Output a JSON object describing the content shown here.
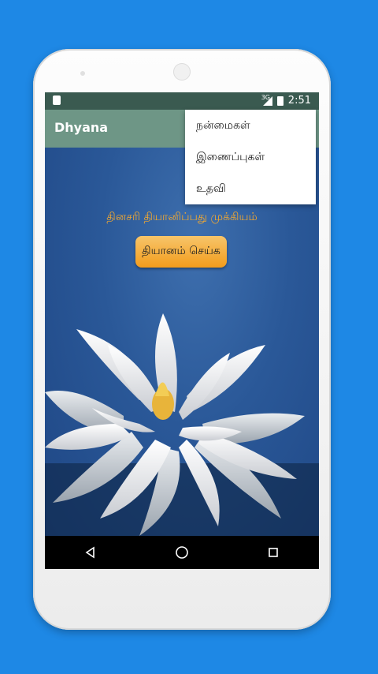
{
  "app": {
    "title": "Dhyana"
  },
  "status_bar": {
    "network": "3G",
    "time": "2:51"
  },
  "content": {
    "tagline": "தினசரி தியானிப்பது முக்கியம்",
    "meditate_button": "தியானம் செய்க"
  },
  "menu": {
    "items": [
      {
        "label": "நன்மைகள்"
      },
      {
        "label": "இணைப்புகள்"
      },
      {
        "label": "உதவி"
      }
    ]
  },
  "colors": {
    "background": "#1e88e5",
    "app_bar": "#6e9686",
    "status_bar": "#3a5a50",
    "accent": "#f39c1c",
    "tagline": "#f2a830"
  }
}
